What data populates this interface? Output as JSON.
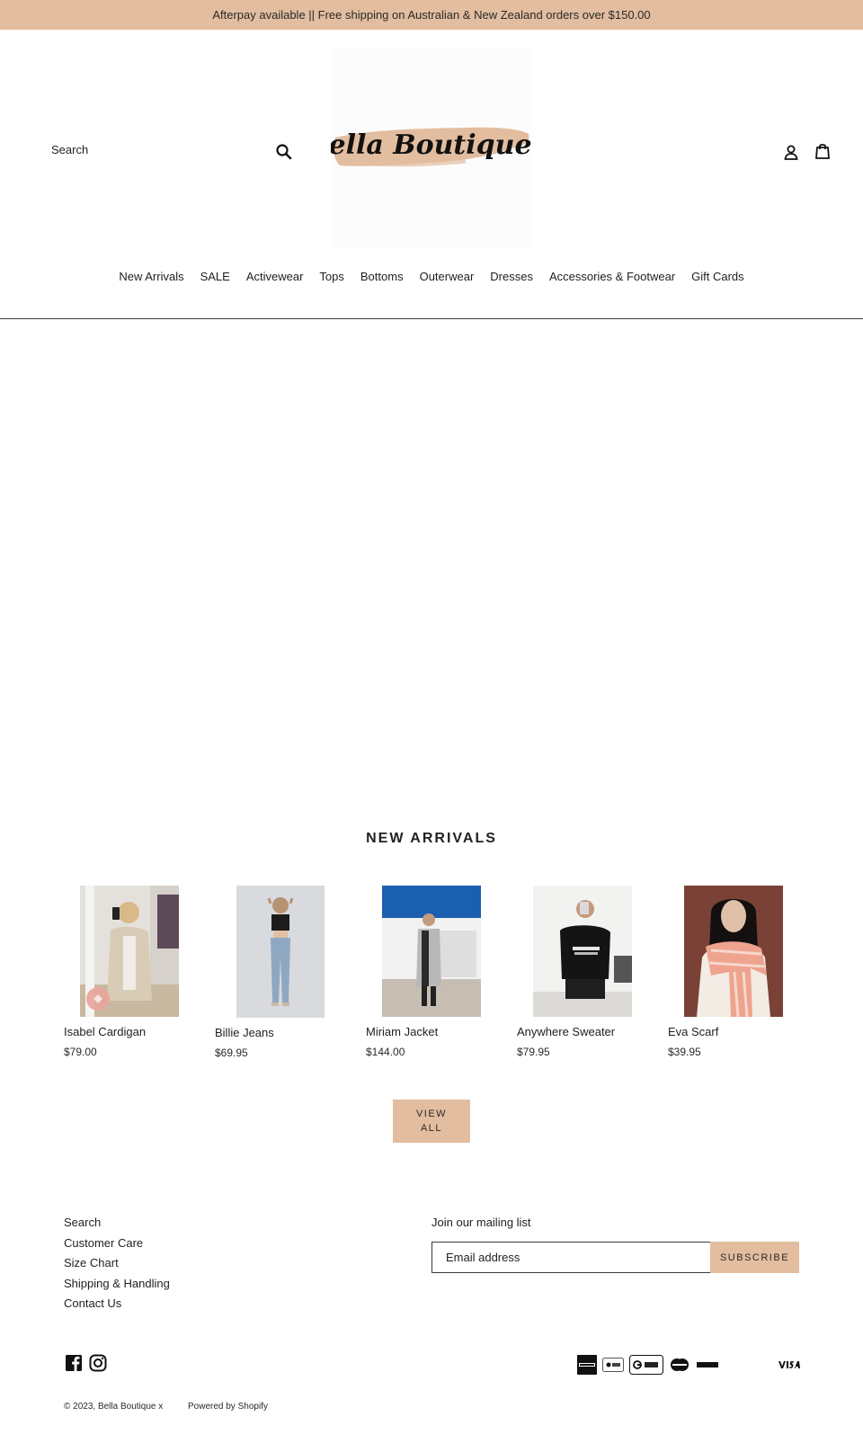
{
  "announcement": "Afterpay available || Free shipping on Australian & New Zealand orders over $150.00",
  "header": {
    "search_label": "Search",
    "logo_text": "Bella Boutique x",
    "search_icon": "search-icon",
    "account_icon": "user-icon",
    "cart_icon": "bag-icon"
  },
  "nav": {
    "items": [
      "New Arrivals",
      "SALE",
      "Activewear",
      "Tops",
      "Bottoms",
      "Outerwear",
      "Dresses",
      "Accessories & Footwear",
      "Gift Cards"
    ]
  },
  "new_arrivals": {
    "title": "NEW ARRIVALS",
    "products": [
      {
        "name": "Isabel Cardigan",
        "price": "$79.00"
      },
      {
        "name": "Billie Jeans",
        "price": "$69.95"
      },
      {
        "name": "Miriam Jacket",
        "price": "$144.00"
      },
      {
        "name": "Anywhere Sweater",
        "price": "$79.95"
      },
      {
        "name": "Eva Scarf",
        "price": "$39.95"
      }
    ],
    "view_all_line1": "VIEW",
    "view_all_line2": "ALL"
  },
  "footer": {
    "links": [
      "Search",
      "Customer Care",
      "Size Chart",
      "Shipping & Handling",
      "Contact Us"
    ],
    "mailing_title": "Join our mailing list",
    "email_placeholder": "Email address",
    "subscribe_label": "SUBSCRIBE",
    "social_icons": [
      "facebook-icon",
      "instagram-icon"
    ],
    "payment_icons": [
      "american-express-icon",
      "apple-pay-icon",
      "google-pay-icon",
      "mastercard-icon",
      "paypal-icon",
      "visa-icon"
    ],
    "copyright": "© 2023, Bella Boutique x",
    "powered_by": "Powered by Shopify"
  },
  "colors": {
    "accent": "#e2bd9f",
    "text": "#1f1f1f",
    "background": "#ffffff"
  }
}
